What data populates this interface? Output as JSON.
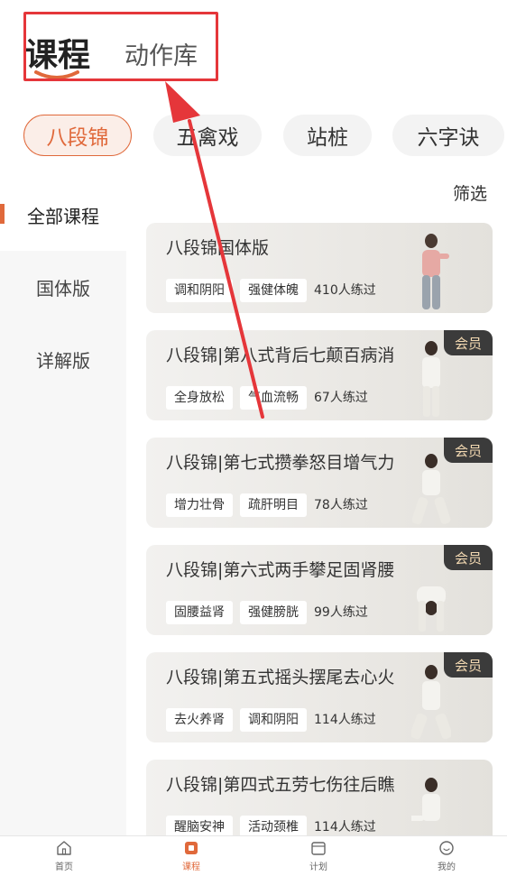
{
  "header": {
    "tab_course": "课程",
    "tab_library": "动作库"
  },
  "categories": [
    {
      "label": "八段锦",
      "active": true
    },
    {
      "label": "五禽戏",
      "active": false
    },
    {
      "label": "站桩",
      "active": false
    },
    {
      "label": "六字诀",
      "active": false
    }
  ],
  "filter_label": "筛选",
  "side_menu": [
    {
      "label": "全部课程",
      "active": true
    },
    {
      "label": "国体版",
      "active": false
    },
    {
      "label": "详解版",
      "active": false
    }
  ],
  "courses": [
    {
      "title": "八段锦国体版",
      "tags": [
        "调和阴阳",
        "强健体魄"
      ],
      "practiced": "410人练过",
      "member": ""
    },
    {
      "title": "八段锦|第八式背后七颠百病消",
      "tags": [
        "全身放松",
        "气血流畅"
      ],
      "practiced": "67人练过",
      "member": "会员"
    },
    {
      "title": "八段锦|第七式攒拳怒目增气力",
      "tags": [
        "增力壮骨",
        "疏肝明目"
      ],
      "practiced": "78人练过",
      "member": "会员"
    },
    {
      "title": "八段锦|第六式两手攀足固肾腰",
      "tags": [
        "固腰益肾",
        "强健膀胱"
      ],
      "practiced": "99人练过",
      "member": "会员"
    },
    {
      "title": "八段锦|第五式摇头摆尾去心火",
      "tags": [
        "去火养肾",
        "调和阴阳"
      ],
      "practiced": "114人练过",
      "member": "会员"
    },
    {
      "title": "八段锦|第四式五劳七伤往后瞧",
      "tags": [
        "醒脑安神",
        "活动颈椎"
      ],
      "practiced": "114人练过",
      "member": ""
    }
  ],
  "bottom_nav": [
    {
      "label": "首页",
      "icon": "home-icon",
      "active": false
    },
    {
      "label": "课程",
      "icon": "course-icon",
      "active": true
    },
    {
      "label": "计划",
      "icon": "plan-icon",
      "active": false
    },
    {
      "label": "我的",
      "icon": "profile-icon",
      "active": false
    }
  ],
  "colors": {
    "accent": "#e0693b",
    "annotation": "#e5363a",
    "badge_bg": "#3b3b3b",
    "badge_text": "#f3d9b2"
  }
}
